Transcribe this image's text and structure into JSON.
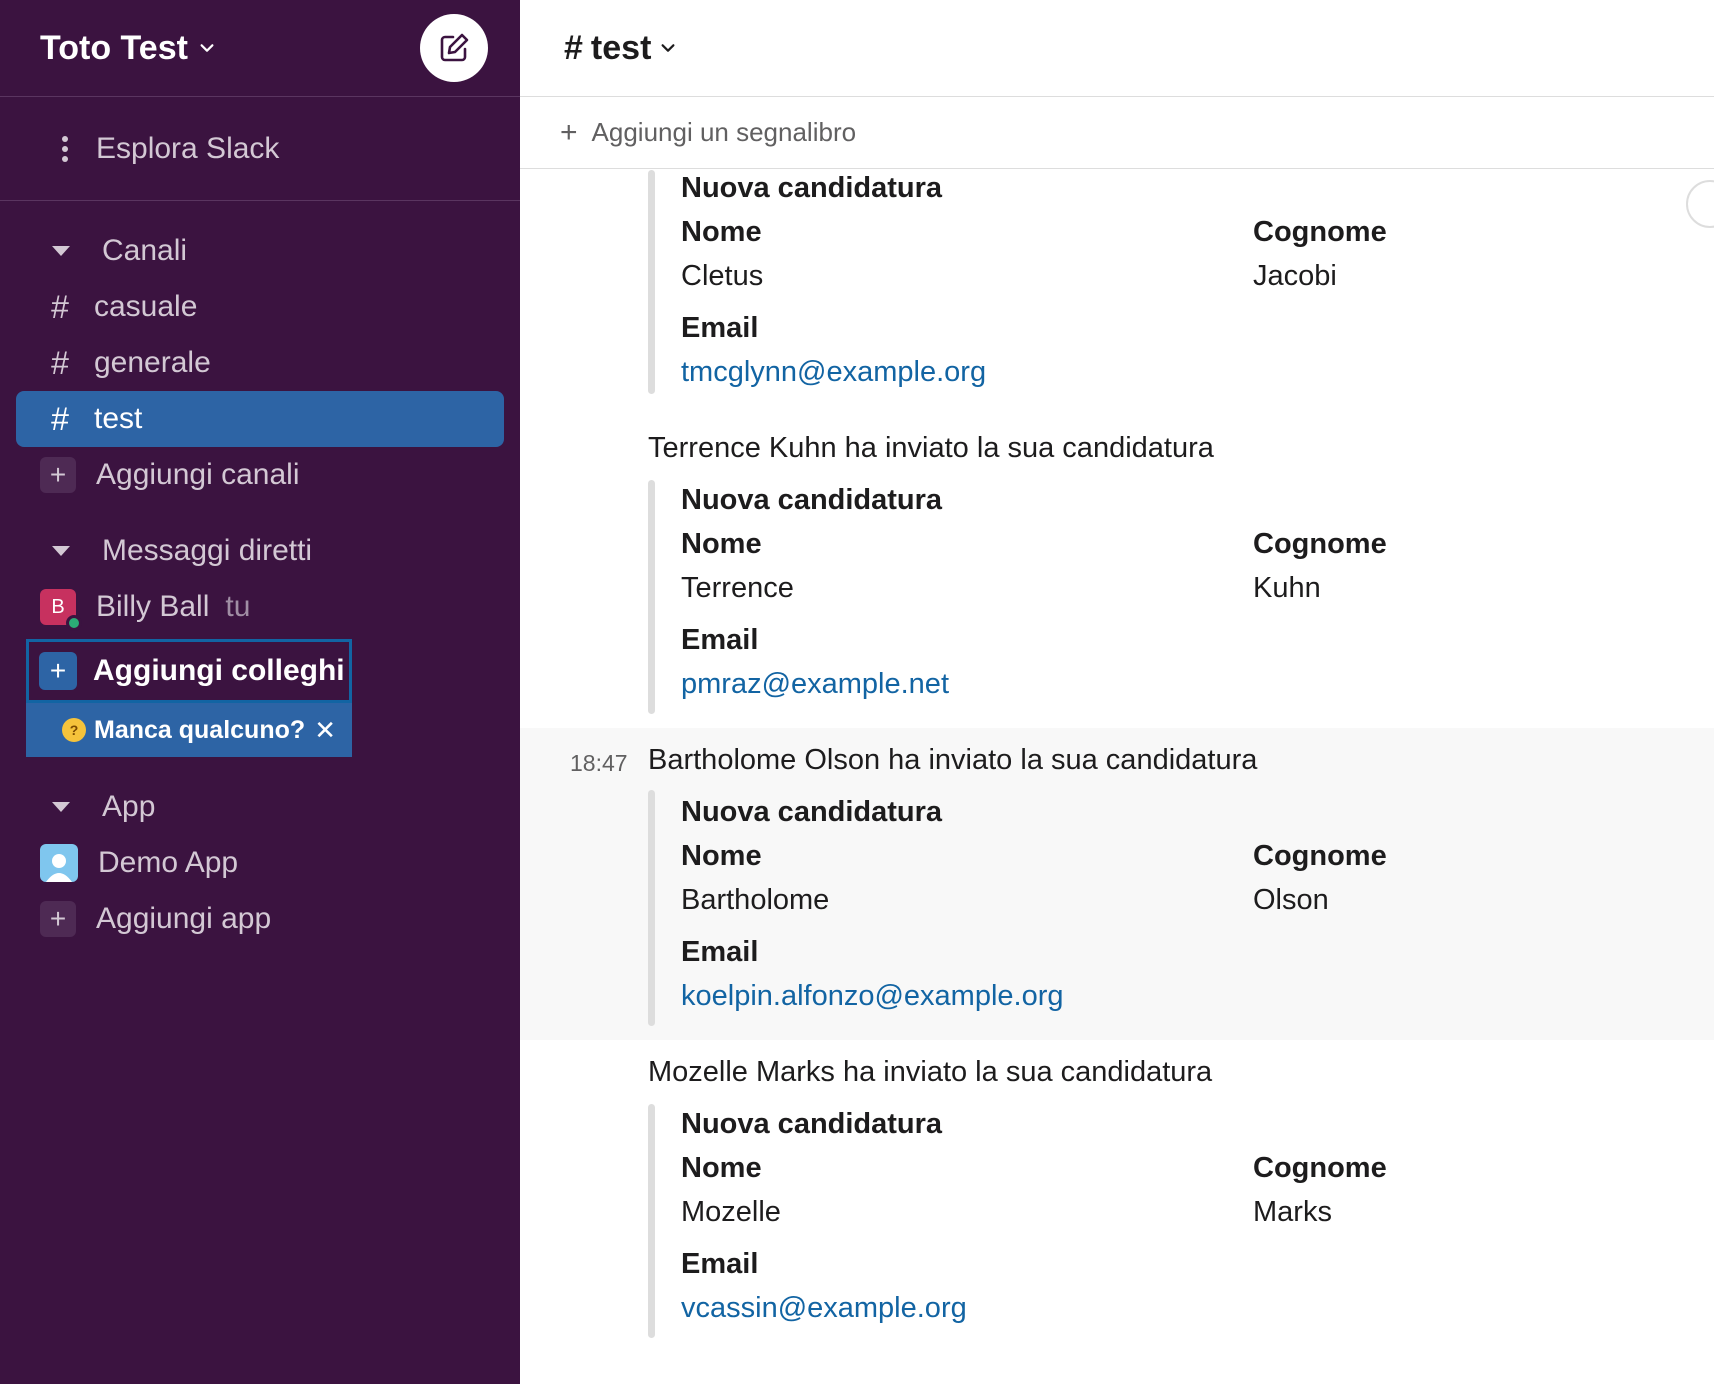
{
  "workspace": {
    "name": "Toto Test"
  },
  "sidebar": {
    "explore_label": "Esplora Slack",
    "channels_header": "Canali",
    "channels": [
      "casuale",
      "generale",
      "test"
    ],
    "add_channels": "Aggiungi canali",
    "dm_header": "Messaggi diretti",
    "dm_user": {
      "initial": "B",
      "name": "Billy Ball",
      "suffix": "tu"
    },
    "invite_label": "Aggiungi colleghi",
    "missing_label": "Manca qualcuno?",
    "missing_close": "✕",
    "apps_header": "App",
    "app_name": "Demo App",
    "add_app": "Aggiungi app"
  },
  "channel": {
    "hash": "#",
    "name": "test",
    "bookmark_label": "Aggiungi un segnalibro"
  },
  "card_labels": {
    "title": "Nuova candidatura",
    "first": "Nome",
    "last": "Cognome",
    "email": "Email"
  },
  "messages": [
    {
      "time": "",
      "text": "",
      "first": "Cletus",
      "last": "Jacobi",
      "email": "tmcglynn@example.org"
    },
    {
      "time": "",
      "text": "Terrence Kuhn ha inviato la sua candidatura",
      "first": "Terrence",
      "last": "Kuhn",
      "email": "pmraz@example.net"
    },
    {
      "time": "18:47",
      "text": "Bartholome Olson ha inviato la sua candidatura",
      "first": "Bartholome",
      "last": "Olson",
      "email": "koelpin.alfonzo@example.org"
    },
    {
      "time": "",
      "text": "Mozelle Marks ha inviato la sua candidatura",
      "first": "Mozelle",
      "last": "Marks",
      "email": "vcassin@example.org"
    }
  ]
}
